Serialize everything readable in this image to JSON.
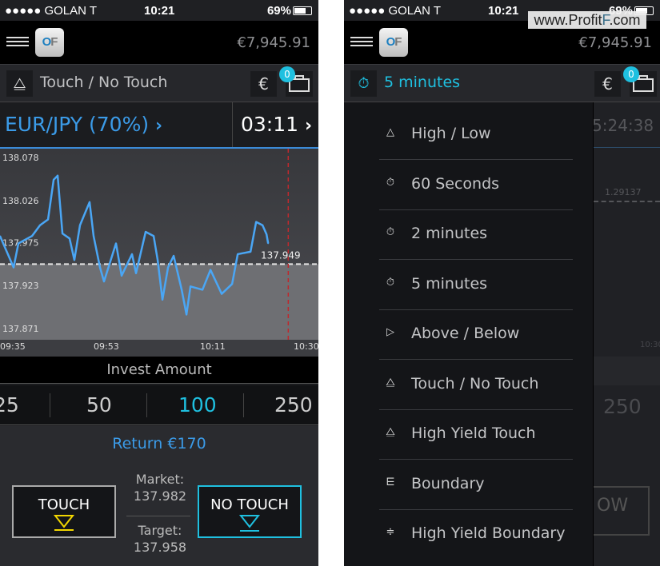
{
  "status_bar": {
    "carrier": "●●●●● GOLAN T",
    "wifi_icon": "wifi-icon",
    "time": "10:21",
    "battery": "69%"
  },
  "header": {
    "logo": "OF",
    "balance": "€7,945.91"
  },
  "left": {
    "option_type": "Touch / No Touch",
    "currency_symbol": "€",
    "portfolio_count": "0",
    "asset": "EUR/JPY (70%)",
    "countdown": "03:11",
    "invest_label": "Invest Amount",
    "amounts": [
      "25",
      "50",
      "100",
      "250"
    ],
    "selected_amount": "100",
    "return_text": "Return €170",
    "touch_label": "TOUCH",
    "no_touch_label": "NO TOUCH",
    "market_label": "Market:",
    "market_value": "137.982",
    "target_label": "Target:",
    "target_value": "137.958"
  },
  "chart_data": {
    "type": "line",
    "y_ticks": [
      "138.078",
      "138.026",
      "137.975",
      "137.923",
      "137.871"
    ],
    "ylim": [
      137.871,
      138.078
    ],
    "x_ticks": [
      "09:35",
      "09:53",
      "10:11",
      "10:30"
    ],
    "xlim": [
      "09:35",
      "10:30"
    ],
    "current_price": 137.949,
    "current_price_label": "137.949",
    "expiry_line": "10:26:54",
    "colors": {
      "line": "#4aa6f5",
      "expiry": "#c0282d",
      "current": "#e6e6e6"
    },
    "points": [
      [
        "09:32:54",
        137.983
      ],
      [
        "09:35:27",
        137.945
      ],
      [
        "09:36:21",
        137.974
      ],
      [
        "09:38:54",
        137.983
      ],
      [
        "09:40:24",
        137.996
      ],
      [
        "09:41:54",
        138.003
      ],
      [
        "09:42:57",
        138.051
      ],
      [
        "09:43:42",
        138.056
      ],
      [
        "09:44:36",
        137.986
      ],
      [
        "09:45:56",
        137.98
      ],
      [
        "09:46:50",
        137.954
      ],
      [
        "09:47:53",
        137.996
      ],
      [
        "09:49:41",
        138.024
      ],
      [
        "09:50:26",
        137.983
      ],
      [
        "09:51:38",
        137.945
      ],
      [
        "09:52:23",
        137.928
      ],
      [
        "09:54:38",
        137.974
      ],
      [
        "09:55:41",
        137.935
      ],
      [
        "09:57:38",
        137.961
      ],
      [
        "09:58:23",
        137.938
      ],
      [
        "10:00:11",
        137.988
      ],
      [
        "10:01:41",
        137.983
      ],
      [
        "10:02:26",
        137.954
      ],
      [
        "10:03:20",
        137.906
      ],
      [
        "10:04:23",
        137.945
      ],
      [
        "10:05:26",
        137.959
      ],
      [
        "10:06:56",
        137.918
      ],
      [
        "10:07:50",
        137.888
      ],
      [
        "10:08:35",
        137.922
      ],
      [
        "10:10:50",
        137.918
      ],
      [
        "10:12:20",
        137.942
      ],
      [
        "10:14:26",
        137.913
      ],
      [
        "10:16:23",
        137.925
      ],
      [
        "10:17:26",
        137.961
      ],
      [
        "10:19:50",
        137.964
      ],
      [
        "10:20:53",
        138.0
      ],
      [
        "10:22:05",
        137.996
      ],
      [
        "10:22:50",
        137.985
      ],
      [
        "10:23:08",
        137.974
      ]
    ]
  },
  "right": {
    "selected_duration": "5 minutes",
    "currency_symbol": "€",
    "portfolio_count": "0",
    "menu": [
      {
        "label": "High / Low",
        "icon": "triangle-up-icon",
        "glyph": "△"
      },
      {
        "label": "60 Seconds",
        "icon": "stopwatch-icon",
        "glyph": "⏱"
      },
      {
        "label": "2 minutes",
        "icon": "stopwatch-icon",
        "glyph": "⏱"
      },
      {
        "label": "5 minutes",
        "icon": "stopwatch-icon",
        "glyph": "⏱"
      },
      {
        "label": "Above / Below",
        "icon": "triangle-right-icon",
        "glyph": "▷"
      },
      {
        "label": "Touch / No Touch",
        "icon": "touch-icon",
        "glyph": "⧋"
      },
      {
        "label": "High Yield Touch",
        "icon": "touch-icon",
        "glyph": "⧋"
      },
      {
        "label": "Boundary",
        "icon": "boundary-icon",
        "glyph": "⋿"
      },
      {
        "label": "High Yield Boundary",
        "icon": "high-yield-boundary-icon",
        "glyph": "≑"
      }
    ],
    "background": {
      "countdown": "5:24:38",
      "price": "1.29137",
      "time_tick": "10:30",
      "amount": "250",
      "button_fragment": "OW"
    }
  },
  "watermark": {
    "prefix": "www.Profit",
    "highlight": "F",
    "suffix": ".com"
  }
}
